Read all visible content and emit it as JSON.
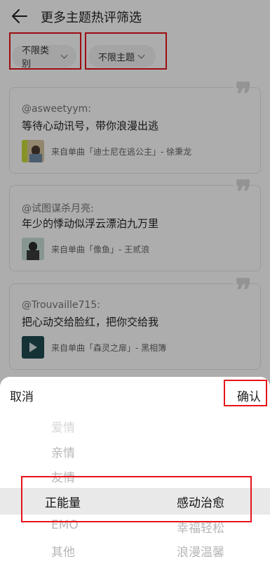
{
  "header": {
    "title": "更多主题热评筛选"
  },
  "filters": [
    {
      "label": "不限类别"
    },
    {
      "label": "不限主题"
    }
  ],
  "cards": [
    {
      "user": "@asweetyym:",
      "text": "等待心动讯号，带你浪漫出逃",
      "song": "来自单曲「迪士尼在逃公主」- 徐秉龙"
    },
    {
      "user": "@试图谋杀月亮:",
      "text": "年少的悸动似浮云漂泊九万里",
      "song": "来自单曲「像鱼」- 王贰浪"
    },
    {
      "user": "@Trouvaille715:",
      "text": "把心动交给脸红，把你交给我",
      "song": "来自单曲「森灵之扉」- 黑相簿"
    }
  ],
  "sheet": {
    "cancel": "取消",
    "confirm": "确认",
    "left_wheel": [
      "爱情",
      "亲情",
      "友情",
      "正能量",
      "EMO",
      "其他"
    ],
    "right_wheel": [
      "感动治愈",
      "幸福轻松",
      "浪漫温馨"
    ]
  },
  "colors": {
    "highlight": "#e5141b",
    "overlay": "rgba(0,0,0,0.32)"
  }
}
